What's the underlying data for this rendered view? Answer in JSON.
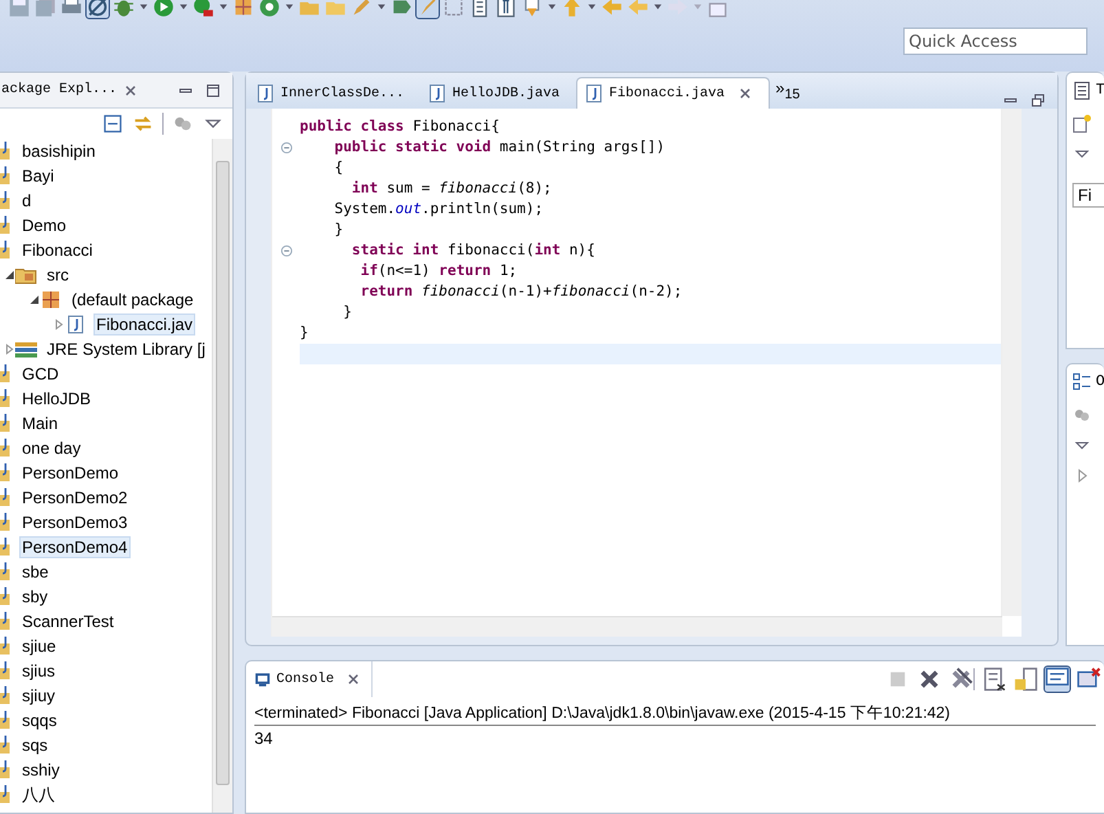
{
  "toolbar": {
    "quick_access": {
      "placeholder": "Quick Access"
    }
  },
  "package_explorer": {
    "title": "ackage Expl...",
    "tree": [
      {
        "label": "basishipin",
        "kind": "project",
        "selected": false
      },
      {
        "label": "Bayi",
        "kind": "project",
        "selected": false
      },
      {
        "label": "d",
        "kind": "project",
        "selected": false
      },
      {
        "label": "Demo",
        "kind": "project",
        "selected": false
      },
      {
        "label": "Fibonacci",
        "kind": "project",
        "selected": false,
        "children": [
          {
            "label": "src",
            "kind": "source-folder",
            "selected": false,
            "expanded": true,
            "children": [
              {
                "label": "(default package",
                "kind": "package",
                "selected": false,
                "expanded": true,
                "children": [
                  {
                    "label": "Fibonacci.jav",
                    "kind": "java-file",
                    "selected": true,
                    "expanded": false
                  }
                ]
              }
            ]
          },
          {
            "label": "JRE System Library [j",
            "kind": "library",
            "selected": false,
            "expanded": false
          }
        ]
      },
      {
        "label": "GCD",
        "kind": "project",
        "selected": false
      },
      {
        "label": "HelloJDB",
        "kind": "project",
        "selected": false
      },
      {
        "label": "Main",
        "kind": "project",
        "selected": false
      },
      {
        "label": "one day",
        "kind": "project",
        "selected": false
      },
      {
        "label": "PersonDemo",
        "kind": "project",
        "selected": false
      },
      {
        "label": "PersonDemo2",
        "kind": "project",
        "selected": false
      },
      {
        "label": "PersonDemo3",
        "kind": "project",
        "selected": false
      },
      {
        "label": "PersonDemo4",
        "kind": "project",
        "selected": true
      },
      {
        "label": "sbe",
        "kind": "project",
        "selected": false
      },
      {
        "label": "sby",
        "kind": "project",
        "selected": false
      },
      {
        "label": "ScannerTest",
        "kind": "project",
        "selected": false
      },
      {
        "label": "sjiue",
        "kind": "project",
        "selected": false
      },
      {
        "label": "sjius",
        "kind": "project",
        "selected": false
      },
      {
        "label": "sjiuy",
        "kind": "project",
        "selected": false
      },
      {
        "label": "sqqs",
        "kind": "project",
        "selected": false
      },
      {
        "label": "sqs",
        "kind": "project",
        "selected": false
      },
      {
        "label": "sshiy",
        "kind": "project",
        "selected": false
      },
      {
        "label": "八八",
        "kind": "project",
        "selected": false
      }
    ]
  },
  "editor": {
    "tabs": [
      {
        "label": "InnerClassDe...",
        "selected": false
      },
      {
        "label": "HelloJDB.java",
        "selected": false
      },
      {
        "label": "Fibonacci.java",
        "selected": true
      }
    ],
    "overflow": "»$_{15}$",
    "lines": [
      {
        "fold": false,
        "current": false,
        "tokens": [
          {
            "kind": "keyword",
            "text": "public class "
          },
          {
            "kind": "plain",
            "text": "Fibonacci{"
          }
        ]
      },
      {
        "fold": true,
        "current": false,
        "tokens": [
          {
            "kind": "keyword",
            "text": "    public static void "
          },
          {
            "kind": "plain",
            "text": "main(String args[])"
          }
        ]
      },
      {
        "fold": false,
        "current": false,
        "tokens": [
          {
            "kind": "plain",
            "text": "    {"
          }
        ]
      },
      {
        "fold": false,
        "current": false,
        "tokens": [
          {
            "kind": "keyword",
            "text": "      int "
          },
          {
            "kind": "plain",
            "text": "sum = "
          },
          {
            "kind": "method",
            "text": "fibonacci"
          },
          {
            "kind": "plain",
            "text": "(8);"
          }
        ]
      },
      {
        "fold": false,
        "current": false,
        "tokens": [
          {
            "kind": "plain",
            "text": "    System."
          },
          {
            "kind": "field",
            "text": "out"
          },
          {
            "kind": "plain",
            "text": ".println(sum);"
          }
        ]
      },
      {
        "fold": false,
        "current": false,
        "tokens": [
          {
            "kind": "plain",
            "text": "    }"
          }
        ]
      },
      {
        "fold": true,
        "current": false,
        "tokens": [
          {
            "kind": "keyword",
            "text": "      static int "
          },
          {
            "kind": "plain",
            "text": "fibonacci("
          },
          {
            "kind": "keyword",
            "text": "int "
          },
          {
            "kind": "plain",
            "text": "n){"
          }
        ]
      },
      {
        "fold": false,
        "current": false,
        "tokens": [
          {
            "kind": "keyword",
            "text": "       if"
          },
          {
            "kind": "plain",
            "text": "(n<=1) "
          },
          {
            "kind": "keyword",
            "text": "return "
          },
          {
            "kind": "plain",
            "text": "1;"
          }
        ]
      },
      {
        "fold": false,
        "current": false,
        "tokens": [
          {
            "kind": "keyword",
            "text": "       return "
          },
          {
            "kind": "method",
            "text": "fibonacci"
          },
          {
            "kind": "plain",
            "text": "(n-1)+"
          },
          {
            "kind": "method",
            "text": "fibonacci"
          },
          {
            "kind": "plain",
            "text": "(n-2);"
          }
        ]
      },
      {
        "fold": false,
        "current": false,
        "tokens": [
          {
            "kind": "plain",
            "text": "     }"
          }
        ]
      },
      {
        "fold": false,
        "current": false,
        "tokens": [
          {
            "kind": "plain",
            "text": "}"
          }
        ]
      },
      {
        "fold": false,
        "current": true
      }
    ]
  },
  "right_panels": {
    "task_title": "T",
    "find_field": {
      "value": "Fi"
    },
    "outline_title": "O"
  },
  "console": {
    "title": "Console",
    "header": "<terminated> Fibonacci [Java Application] D:\\Java\\jdk1.8.0\\bin\\javaw.exe (2015-4-15 下午10:21:42)",
    "output": "34"
  }
}
